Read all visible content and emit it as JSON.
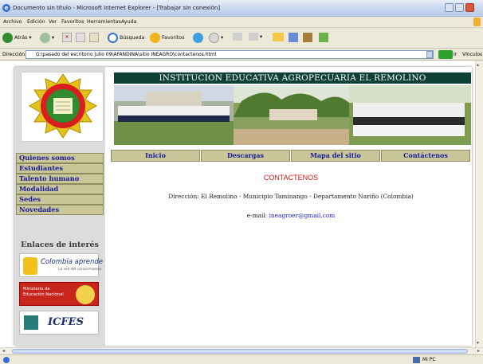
{
  "window": {
    "title": "Documento sin título - Microsoft Internet Explorer - [Trabajar sin conexión]"
  },
  "menu": [
    "Archivo",
    "Edición",
    "Ver",
    "Favoritos",
    "Herramientas",
    "Ayuda"
  ],
  "toolbar": {
    "back": "Atrás",
    "search": "Búsqueda",
    "favorites": "Favoritos"
  },
  "address": {
    "label": "Dirección",
    "value": "G:\\pasado del escritorio julio 09\\AFANDINA\\sitio INEAGRO\\contactenos.html",
    "go": "Ir",
    "links": "Vínculos"
  },
  "page": {
    "banner": "INSTITUCION EDUCATIVA AGROPECUARIA EL REMOLINO",
    "left_menu": [
      "Quienes somos",
      "Estudiantes",
      "Talento humano",
      "Modalidad",
      "Sedes",
      "Novedades"
    ],
    "enlaces_title": "Enlaces de interés",
    "links": {
      "colombia_aprende": "Colombia aprende",
      "colombia_aprende_sub": "La red del conocimiento",
      "mineducacion": "Ministerio de Educación Nacional",
      "icfes": "ICFES"
    },
    "top_nav": [
      "Inicio",
      "Descargas",
      "Mapa del sitio",
      "Contáctenos"
    ],
    "heading": "CONTACTENOS",
    "direccion": "Dirección: El Remolino - Municipio Taminango - Departamento Nariño (Colombia)",
    "email_label": "e-mail: ",
    "email": "ineagroer@gmail.com"
  },
  "status": {
    "zone": "Mi PC"
  },
  "colors": {
    "nav_bg": "#c9c79a",
    "banner_bg": "#0f4035",
    "heading": "#d11919",
    "link": "#1a1acc"
  }
}
